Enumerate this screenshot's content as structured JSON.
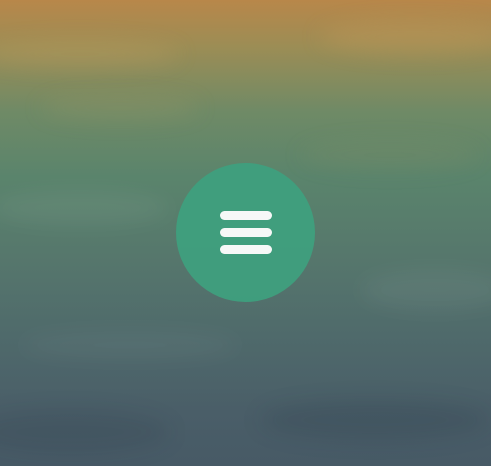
{
  "background": {
    "description_colors": {
      "top": "#b8874a",
      "middle": "#5a846c",
      "bottom": "#475a66"
    }
  },
  "menu_button": {
    "icon": "hamburger-menu-icon",
    "color": "#3fa07e",
    "icon_color": "#ffffff"
  }
}
